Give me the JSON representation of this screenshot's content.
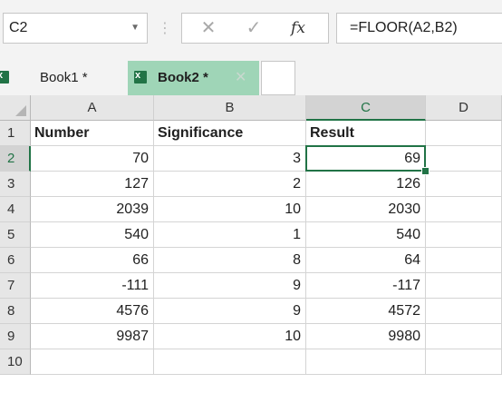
{
  "formula_bar": {
    "name_box": "C2",
    "name_box_dropdown_icon": "triangle-down",
    "separator": "⋮",
    "cancel_symbol": "✕",
    "enter_symbol": "✓",
    "function_symbol": "fx",
    "formula": "=FLOOR(A2,B2)"
  },
  "workbooks": {
    "book1": {
      "label": "Book1 *",
      "icon": "excel-icon"
    },
    "book2": {
      "label": "Book2 *",
      "icon": "excel-icon",
      "close_symbol": "✕",
      "active": true
    },
    "active_color": "#9fd5b7"
  },
  "sheet": {
    "columns": [
      "A",
      "B",
      "C",
      "D"
    ],
    "active_column": "C",
    "active_row": "2",
    "accent_color": "#217346",
    "rows": [
      {
        "row": "1",
        "cells": [
          "Number",
          "Significance",
          "Result",
          ""
        ]
      },
      {
        "row": "2",
        "cells": [
          "70",
          "3",
          "69",
          ""
        ]
      },
      {
        "row": "3",
        "cells": [
          "127",
          "2",
          "126",
          ""
        ]
      },
      {
        "row": "4",
        "cells": [
          "2039",
          "10",
          "2030",
          ""
        ]
      },
      {
        "row": "5",
        "cells": [
          "540",
          "1",
          "540",
          ""
        ]
      },
      {
        "row": "6",
        "cells": [
          "66",
          "8",
          "64",
          ""
        ]
      },
      {
        "row": "7",
        "cells": [
          "-111",
          "9",
          "-117",
          ""
        ]
      },
      {
        "row": "8",
        "cells": [
          "4576",
          "9",
          "4572",
          ""
        ]
      },
      {
        "row": "9",
        "cells": [
          "9987",
          "10",
          "9980",
          ""
        ]
      },
      {
        "row": "10",
        "cells": [
          "",
          "",
          "",
          ""
        ]
      }
    ]
  }
}
